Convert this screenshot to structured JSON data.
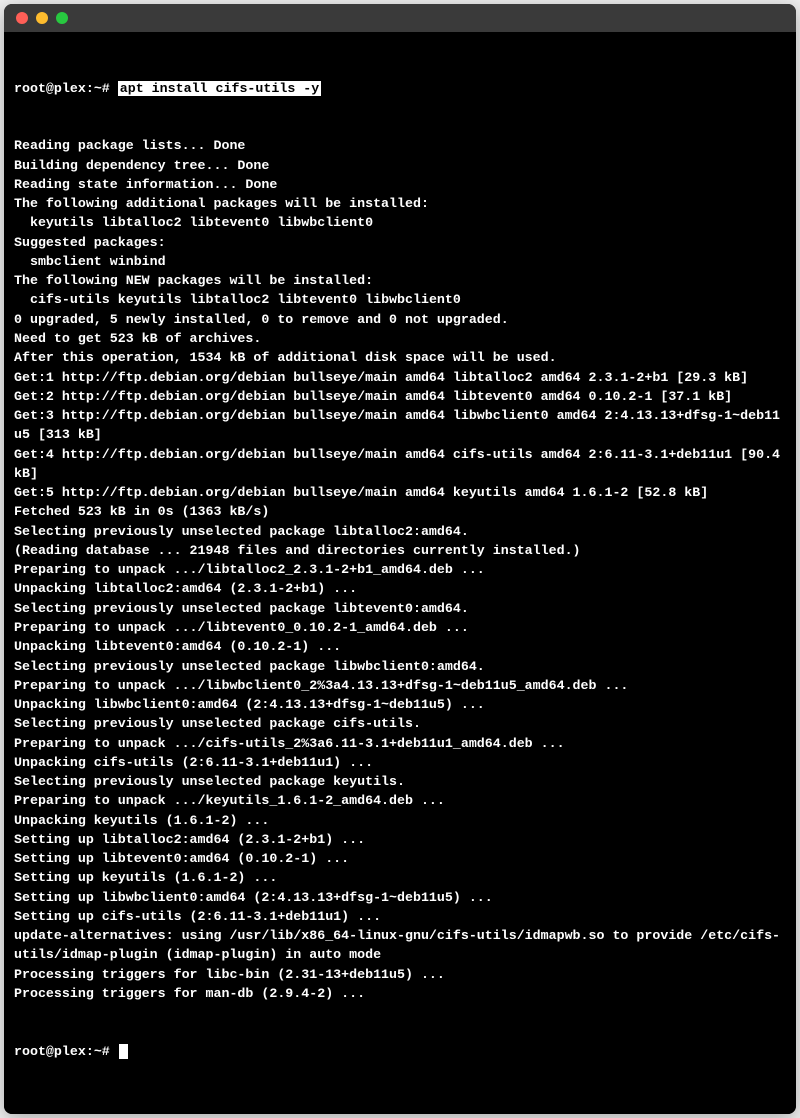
{
  "prompt": {
    "user_host": "root@plex",
    "cwd_symbol": "~",
    "prompt_char": "#",
    "command": "apt install cifs-utils -y"
  },
  "output_lines": [
    "Reading package lists... Done",
    "Building dependency tree... Done",
    "Reading state information... Done",
    "The following additional packages will be installed:",
    "  keyutils libtalloc2 libtevent0 libwbclient0",
    "Suggested packages:",
    "  smbclient winbind",
    "The following NEW packages will be installed:",
    "  cifs-utils keyutils libtalloc2 libtevent0 libwbclient0",
    "0 upgraded, 5 newly installed, 0 to remove and 0 not upgraded.",
    "Need to get 523 kB of archives.",
    "After this operation, 1534 kB of additional disk space will be used.",
    "Get:1 http://ftp.debian.org/debian bullseye/main amd64 libtalloc2 amd64 2.3.1-2+b1 [29.3 kB]",
    "Get:2 http://ftp.debian.org/debian bullseye/main amd64 libtevent0 amd64 0.10.2-1 [37.1 kB]",
    "Get:3 http://ftp.debian.org/debian bullseye/main amd64 libwbclient0 amd64 2:4.13.13+dfsg-1~deb11u5 [313 kB]",
    "Get:4 http://ftp.debian.org/debian bullseye/main amd64 cifs-utils amd64 2:6.11-3.1+deb11u1 [90.4 kB]",
    "Get:5 http://ftp.debian.org/debian bullseye/main amd64 keyutils amd64 1.6.1-2 [52.8 kB]",
    "Fetched 523 kB in 0s (1363 kB/s)",
    "Selecting previously unselected package libtalloc2:amd64.",
    "(Reading database ... 21948 files and directories currently installed.)",
    "Preparing to unpack .../libtalloc2_2.3.1-2+b1_amd64.deb ...",
    "Unpacking libtalloc2:amd64 (2.3.1-2+b1) ...",
    "Selecting previously unselected package libtevent0:amd64.",
    "Preparing to unpack .../libtevent0_0.10.2-1_amd64.deb ...",
    "Unpacking libtevent0:amd64 (0.10.2-1) ...",
    "Selecting previously unselected package libwbclient0:amd64.",
    "Preparing to unpack .../libwbclient0_2%3a4.13.13+dfsg-1~deb11u5_amd64.deb ...",
    "Unpacking libwbclient0:amd64 (2:4.13.13+dfsg-1~deb11u5) ...",
    "Selecting previously unselected package cifs-utils.",
    "Preparing to unpack .../cifs-utils_2%3a6.11-3.1+deb11u1_amd64.deb ...",
    "Unpacking cifs-utils (2:6.11-3.1+deb11u1) ...",
    "Selecting previously unselected package keyutils.",
    "Preparing to unpack .../keyutils_1.6.1-2_amd64.deb ...",
    "Unpacking keyutils (1.6.1-2) ...",
    "Setting up libtalloc2:amd64 (2.3.1-2+b1) ...",
    "Setting up libtevent0:amd64 (0.10.2-1) ...",
    "Setting up keyutils (1.6.1-2) ...",
    "Setting up libwbclient0:amd64 (2:4.13.13+dfsg-1~deb11u5) ...",
    "Setting up cifs-utils (2:6.11-3.1+deb11u1) ...",
    "update-alternatives: using /usr/lib/x86_64-linux-gnu/cifs-utils/idmapwb.so to provide /etc/cifs-utils/idmap-plugin (idmap-plugin) in auto mode",
    "Processing triggers for libc-bin (2.31-13+deb11u5) ...",
    "Processing triggers for man-db (2.9.4-2) ..."
  ],
  "final_prompt": {
    "user_host": "root@plex",
    "cwd_symbol": "~",
    "prompt_char": "#"
  }
}
